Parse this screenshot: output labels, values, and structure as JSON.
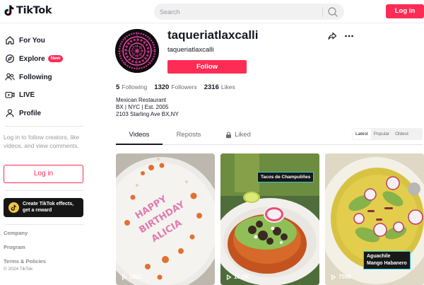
{
  "header": {
    "logo_text": "TikTok",
    "search_placeholder": "Search",
    "login_label": "Log in"
  },
  "sidebar": {
    "items": [
      {
        "label": "For You",
        "icon": "home-icon"
      },
      {
        "label": "Explore",
        "icon": "compass-icon",
        "badge": "New"
      },
      {
        "label": "Following",
        "icon": "people-icon"
      },
      {
        "label": "LIVE",
        "icon": "live-icon"
      },
      {
        "label": "Profile",
        "icon": "person-icon"
      }
    ],
    "login_prompt": "Log in to follow creators, like videos, and view comments.",
    "login_label": "Log in",
    "effects_label": "Create TikTok effects, get a reward",
    "footer": [
      "Company",
      "Program",
      "Terms & Policies"
    ],
    "copyright": "© 2024 TikTok"
  },
  "profile": {
    "username": "taqueriatlaxcalli",
    "nickname": "taqueriatlaxcalli",
    "follow_label": "Follow",
    "stats": [
      {
        "value": "5",
        "label": "Following"
      },
      {
        "value": "1320",
        "label": "Followers"
      },
      {
        "value": "2316",
        "label": "Likes"
      }
    ],
    "bio": [
      "Mexican Restaurant",
      "BX | NYC | Est. 2005",
      "2103 Starling Ave BX,NY"
    ]
  },
  "tabs": [
    {
      "label": "Videos",
      "active": true
    },
    {
      "label": "Reposts",
      "active": false
    },
    {
      "label": "Liked",
      "active": false,
      "icon": "lock-icon"
    }
  ],
  "sort_options": [
    {
      "label": "Latest",
      "active": true
    },
    {
      "label": "Popular",
      "active": false
    },
    {
      "label": "Oldest",
      "active": false
    }
  ],
  "videos": [
    {
      "views": "1862",
      "caption": ""
    },
    {
      "views": "13.1K",
      "caption": "Tacos de Champuliñes"
    },
    {
      "views": "7598",
      "caption_lines": [
        "Aguachile",
        "Mango Habanero"
      ]
    }
  ],
  "colors": {
    "accent": "#fe2c55",
    "text": "#161823",
    "muted": "#9a9a9e"
  }
}
